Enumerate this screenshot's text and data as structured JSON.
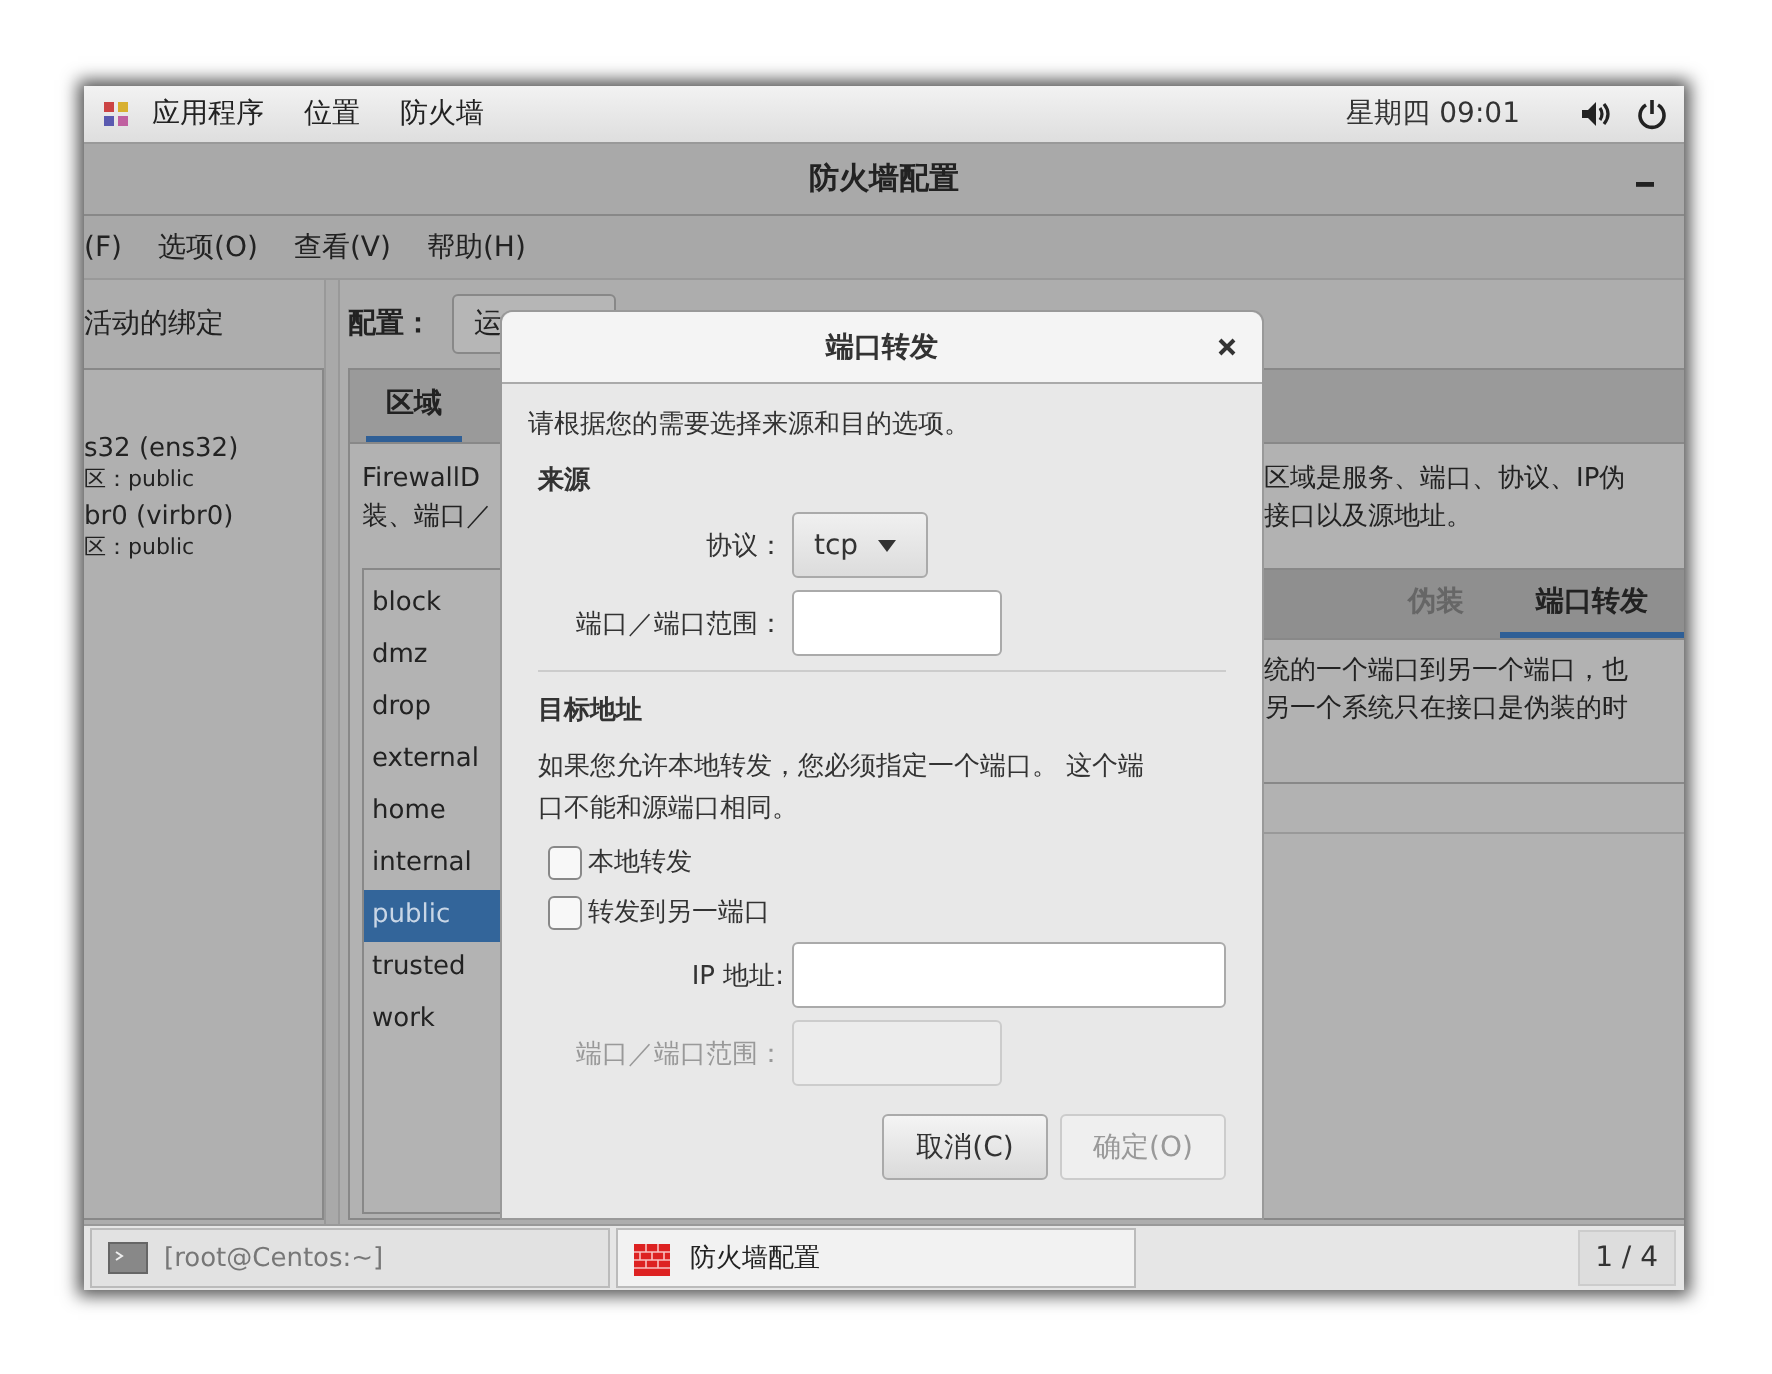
{
  "top_bar": {
    "menus": [
      "应用程序",
      "位置",
      "防火墙"
    ],
    "clock": "星期四 09:01"
  },
  "window": {
    "title": "防火墙配置",
    "menu": [
      "(F)",
      "选项(O)",
      "查看(V)",
      "帮助(H)"
    ]
  },
  "bindings": {
    "heading": "活动的绑定",
    "items": [
      {
        "name": "s32 (ens32)",
        "zone": "区：public"
      },
      {
        "name": "br0 (virbr0)",
        "zone": "区：public"
      }
    ]
  },
  "configuration": {
    "label": "配置：",
    "value": "运"
  },
  "tabs": [
    {
      "label": "区域",
      "selected": true
    }
  ],
  "description_left": [
    "FirewallD",
    "装、端口／"
  ],
  "description_right": [
    "区域是服务、端口、协议、IP伪",
    "接口以及源地址。"
  ],
  "zones": [
    {
      "name": "block",
      "selected": false
    },
    {
      "name": "dmz",
      "selected": false
    },
    {
      "name": "drop",
      "selected": false
    },
    {
      "name": "external",
      "selected": false
    },
    {
      "name": "home",
      "selected": false
    },
    {
      "name": "internal",
      "selected": false
    },
    {
      "name": "public",
      "selected": true
    },
    {
      "name": "trusted",
      "selected": false
    },
    {
      "name": "work",
      "selected": false
    }
  ],
  "zone_tabs": [
    {
      "label": "伪装",
      "selected": false
    },
    {
      "label": "端口转发",
      "selected": true
    }
  ],
  "zone_tab_text": [
    "统的一个端口到另一个端口，也",
    "另一个系统只在接口是伪装的时"
  ],
  "dialog": {
    "title": "端口转发",
    "intro": "请根据您的需要选择来源和目的选项。",
    "source": {
      "heading": "来源",
      "protocol_label": "协议：",
      "protocol": "tcp",
      "port_label": "端口／端口范围："
    },
    "destination": {
      "heading": "目标地址",
      "note": "如果您允许本地转发，您必须指定一个端口。 这个端口不能和源端口相同。",
      "checks": [
        {
          "label": "本地转发",
          "checked": false
        },
        {
          "label": "转发到另一端口",
          "checked": false
        }
      ],
      "ip_label": "IP 地址:",
      "port_label": "端口／端口范围：",
      "port_disabled": true
    },
    "buttons": [
      {
        "label": "取消(C)",
        "disabled": false
      },
      {
        "label": "确定(O)",
        "disabled": true
      }
    ]
  },
  "taskbar": {
    "items": [
      {
        "label": "[root@Centos:~]",
        "selected": false
      },
      {
        "label": "防火墙配置",
        "selected": true
      }
    ],
    "workspace": "1 / 4"
  }
}
